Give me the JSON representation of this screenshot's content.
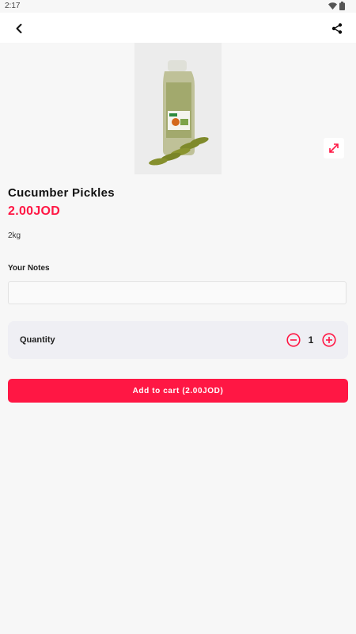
{
  "status_bar": {
    "time": "2:17"
  },
  "app_bar": {
    "back_icon": "chevron-left-icon",
    "share_icon": "share-icon"
  },
  "product": {
    "image_alt": "Cucumber Pickles",
    "name": "Cucumber Pickles",
    "price": "2.00JOD",
    "weight": "2kg"
  },
  "notes": {
    "label": "Your Notes",
    "value": "",
    "placeholder": ""
  },
  "quantity": {
    "label": "Quantity",
    "value": "1"
  },
  "cart": {
    "button_label": "Add to cart (2.00JOD)"
  },
  "colors": {
    "accent": "#ff1744",
    "background": "#f7f7f7",
    "card": "#efeff4"
  }
}
